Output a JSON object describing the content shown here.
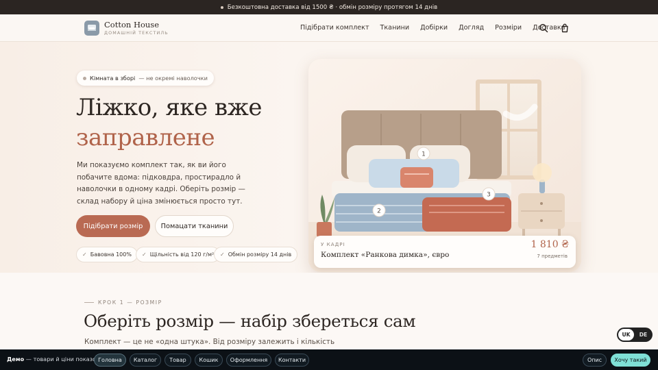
{
  "announcement": "Безкоштовна доставка від 1500 ₴ · обмін розміру протягом 14 днів",
  "brand": {
    "name": "Cotton House",
    "tagline": "ДОМАШНІЙ ТЕКСТИЛЬ"
  },
  "nav": [
    "Підібрати комплект",
    "Тканини",
    "Добірки",
    "Догляд",
    "Розміри",
    "Доставка"
  ],
  "hero": {
    "chip_bold": "Кімната в зборі",
    "chip_rest": "— не окремі наволочки",
    "title_line1": "Ліжко, яке вже",
    "title_line2": "заправлене",
    "lead": "Ми показуємо комплект так, як ви його побачите вдома: підковдра, простирадло й наволочки в одному кадрі. Оберіть розмір — склад набору й ціна змінюється просто тут.",
    "primary_cta": "Підібрати розмір",
    "secondary_cta": "Помацати тканини",
    "features": [
      "Бавовна 100%",
      "Щільність від 120 г/м²",
      "Обмін розміру 14 днів"
    ]
  },
  "scene": {
    "markers": [
      "1",
      "2",
      "3"
    ],
    "caption_tag": "У КАДРІ",
    "caption_title": "Комплект «Ранкова димка», євро",
    "price": "1 810 ₴",
    "items_count": "7 предметів"
  },
  "section": {
    "kicker": "КРОК 1 — РОЗМІР",
    "title": "Оберіть розмір — набір збереться сам",
    "subtitle": "Комплект — це не «одна штука». Від розміру залежить і кількість"
  },
  "language": {
    "active": "UK",
    "other": "DE"
  },
  "demo_bar": {
    "label_bold": "Демо",
    "label_rest": "— товари й ціни показові:",
    "pages": [
      "Головна",
      "Каталог",
      "Товар",
      "Кошик",
      "Оформлення",
      "Контакти"
    ],
    "active_page": "Головна",
    "about": "Опис",
    "want": "Хочу такий"
  },
  "colors": {
    "accent": "#b96a53",
    "dark": "#2b2522",
    "demo_accent": "#7fe0d6"
  }
}
